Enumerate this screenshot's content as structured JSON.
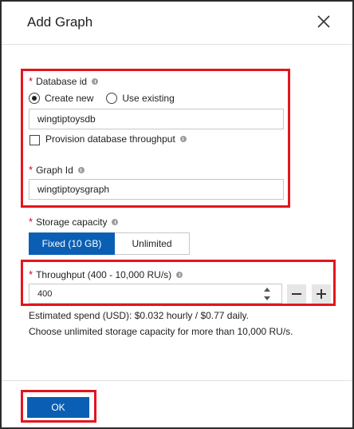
{
  "dialog": {
    "title": "Add Graph",
    "close_icon": "close-icon"
  },
  "database": {
    "label": "Database id",
    "options": [
      "Create new",
      "Use existing"
    ],
    "selected": "Create new",
    "value": "wingtiptoysdb",
    "provision_label": "Provision database throughput",
    "provision_checked": false
  },
  "graph": {
    "label": "Graph Id",
    "value": "wingtiptoysgraph"
  },
  "storage": {
    "label": "Storage capacity",
    "options": [
      "Fixed (10 GB)",
      "Unlimited"
    ],
    "selected": "Fixed (10 GB)"
  },
  "throughput": {
    "label": "Throughput (400 - 10,000 RU/s)",
    "value": "400",
    "decrement_icon": "minus-icon",
    "increment_icon": "plus-icon"
  },
  "info": {
    "spend": "Estimated spend (USD): $0.032 hourly / $0.77 daily.",
    "note": "Choose unlimited storage capacity for more than 10,000 RU/s."
  },
  "footer": {
    "ok_label": "OK"
  },
  "colors": {
    "accent": "#0a5fb4",
    "highlight": "#e3151f",
    "required": "#d0021b"
  }
}
